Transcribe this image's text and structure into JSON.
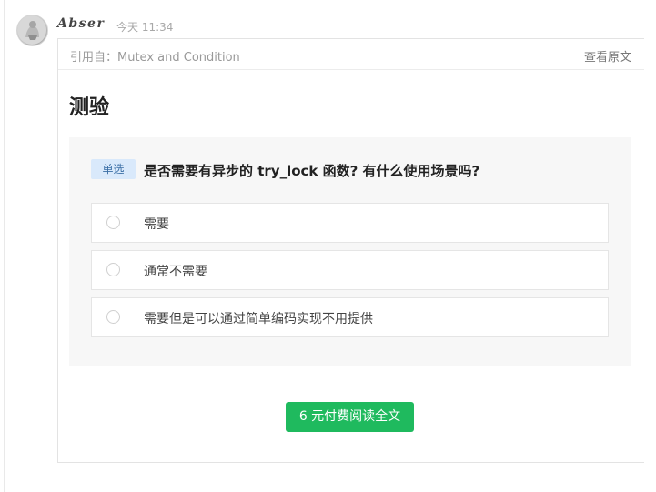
{
  "author": {
    "name": "Abser",
    "timestamp": "今天 11:34"
  },
  "quote": {
    "source_text": "引用自：Mutex and Condition",
    "view_original_label": "查看原文",
    "title": "测验"
  },
  "quiz": {
    "type_label": "单选",
    "question": "是否需要有异步的 try_lock 函数? 有什么使用场景吗?",
    "options": [
      {
        "label": "需要"
      },
      {
        "label": "通常不需要"
      },
      {
        "label": "需要但是可以通过简单编码实现不用提供"
      }
    ]
  },
  "pay_button_label": "6 元付费阅读全文",
  "colors": {
    "accent_green": "#1fba5e",
    "tag_bg": "#d9e9fb",
    "tag_text": "#3a6ea5"
  }
}
